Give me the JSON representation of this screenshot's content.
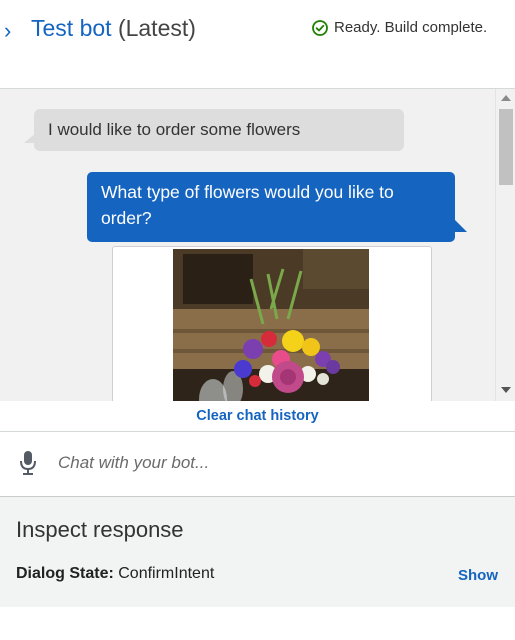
{
  "header": {
    "bot_name": "Test bot",
    "version_label": "(Latest)",
    "status_text": "Ready. Build complete.",
    "status_color": "#1d8102"
  },
  "chat": {
    "messages": [
      {
        "from": "user",
        "text": "I would like to order some flowers"
      },
      {
        "from": "bot",
        "text": "What type of flowers would you like to order?"
      }
    ],
    "card_image": "flower-bouquet-photo",
    "clear_label": "Clear chat history"
  },
  "input": {
    "placeholder": "Chat with your bot..."
  },
  "inspect": {
    "title": "Inspect response",
    "dialog_state_label": "Dialog State:",
    "dialog_state_value": "ConfirmIntent",
    "show_label": "Show"
  },
  "colors": {
    "accent": "#1565c0",
    "user_bubble": "#dddddd",
    "bot_bubble": "#1565c0"
  }
}
